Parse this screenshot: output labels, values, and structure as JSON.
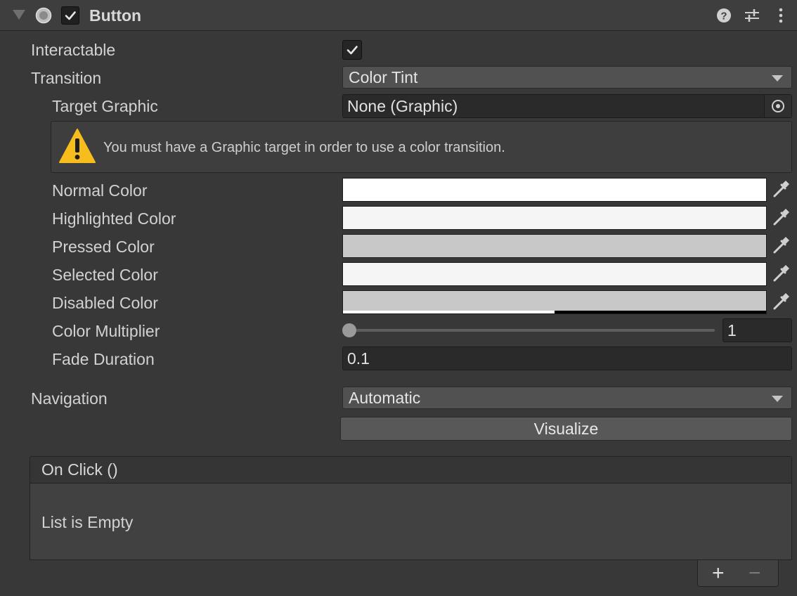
{
  "component": {
    "title": "Button",
    "enabled": true
  },
  "fields": {
    "interactable_label": "Interactable",
    "interactable_checked": true,
    "transition_label": "Transition",
    "transition_value": "Color Tint",
    "target_graphic_label": "Target Graphic",
    "target_graphic_value": "None (Graphic)",
    "warning_message": "You must have a Graphic target in order to use a color transition.",
    "normal_color_label": "Normal Color",
    "normal_color": "#FFFFFF",
    "highlighted_color_label": "Highlighted Color",
    "highlighted_color": "#F5F5F5",
    "pressed_color_label": "Pressed Color",
    "pressed_color": "#C8C8C8",
    "selected_color_label": "Selected Color",
    "selected_color": "#F5F5F5",
    "disabled_color_label": "Disabled Color",
    "disabled_color": "#C8C8C8",
    "disabled_alpha": 0.5,
    "color_multiplier_label": "Color Multiplier",
    "color_multiplier_value": "1",
    "fade_duration_label": "Fade Duration",
    "fade_duration_value": "0.1",
    "navigation_label": "Navigation",
    "navigation_value": "Automatic",
    "visualize_label": "Visualize"
  },
  "event": {
    "header": "On Click ()",
    "empty_text": "List is Empty",
    "add_label": "+",
    "remove_label": "−"
  },
  "icons": {
    "foldout": "foldout-triangle-icon",
    "component": "button-component-icon",
    "help": "help-icon",
    "presets": "presets-icon",
    "menu": "kebab-menu-icon",
    "warning": "warning-icon",
    "eyedropper": "eyedropper-icon",
    "object_picker": "object-picker-icon"
  }
}
